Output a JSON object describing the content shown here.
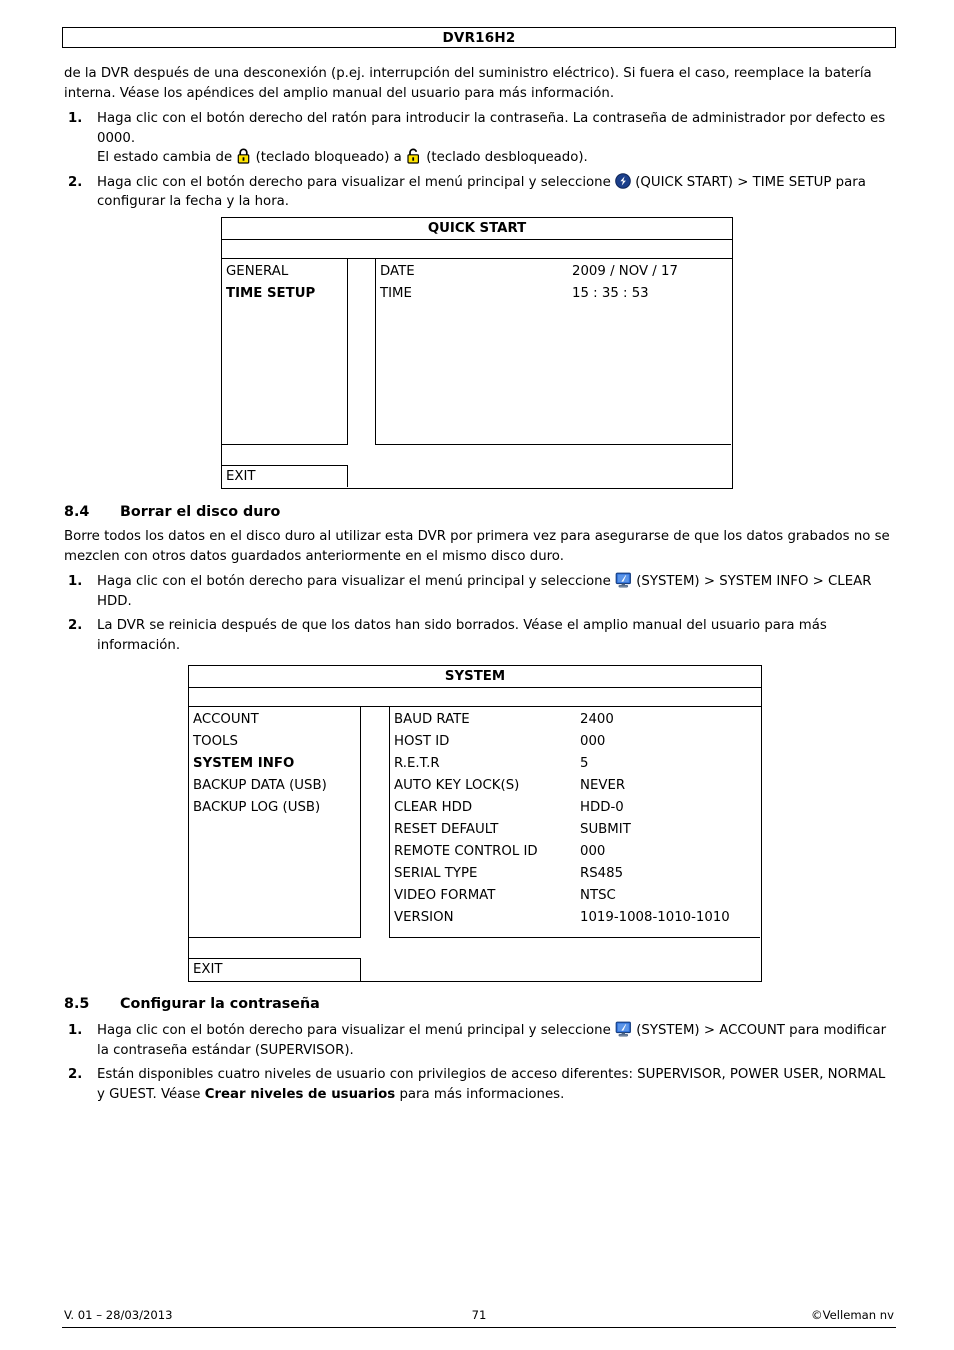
{
  "header": {
    "title": "DVR16H2"
  },
  "intro": {
    "paragraph": "de la DVR después de una desconexión (p.ej. interrupción del suministro eléctrico). Si fuera el caso, reemplace la batería interna. Véase los apéndices del amplio manual del usuario para más información."
  },
  "list_intro": {
    "item1_line1": "Haga clic con el botón derecho del ratón para introducir la contraseña. La contraseña de administrador por defecto es 0000.",
    "item1_line2_a": "El estado cambia de",
    "item1_line2_b": "(teclado bloqueado) a",
    "item1_line2_c": "(teclado desbloqueado).",
    "item1_num": "1.",
    "item2_num": "2.",
    "item2_a": "Haga clic con el botón derecho para visualizar el menú principal y seleccione",
    "item2_b": "(QUICK START) > TIME SETUP para configurar la fecha y la hora."
  },
  "quick_start_menu": {
    "title": "QUICK START",
    "left_items": [
      {
        "label": "GENERAL",
        "active": false
      },
      {
        "label": "TIME SETUP",
        "active": true
      }
    ],
    "rows": [
      {
        "key": "DATE",
        "value": "2009 / NOV / 17"
      },
      {
        "key": "TIME",
        "value": "15 : 35 : 53"
      }
    ],
    "exit_label": "EXIT"
  },
  "section_84": {
    "number": "8.4",
    "title": "Borrar el disco duro",
    "paragraph": "Borre todos los datos en el disco duro al utilizar esta DVR por primera vez para asegurarse de que los datos grabados no se mezclen con otros datos guardados anteriormente en el mismo disco duro.",
    "item1_num": "1.",
    "item1_a": "Haga clic con el botón derecho para visualizar el menú principal y seleccione",
    "item1_b": "(SYSTEM) > SYSTEM INFO > CLEAR HDD.",
    "item2_num": "2.",
    "item2": "La DVR se reinicia después de que los datos han sido borrados. Véase el amplio manual del usuario para más información."
  },
  "system_menu": {
    "title": "SYSTEM",
    "left_items": [
      {
        "label": "ACCOUNT",
        "active": false
      },
      {
        "label": "TOOLS",
        "active": false
      },
      {
        "label": "SYSTEM INFO",
        "active": true
      },
      {
        "label": "BACKUP DATA (USB)",
        "active": false
      },
      {
        "label": "BACKUP LOG (USB)",
        "active": false
      }
    ],
    "rows": [
      {
        "key": "BAUD RATE",
        "value": "2400"
      },
      {
        "key": "HOST ID",
        "value": "000"
      },
      {
        "key": "R.E.T.R",
        "value": "5"
      },
      {
        "key": "AUTO KEY LOCK(S)",
        "value": "NEVER"
      },
      {
        "key": "CLEAR HDD",
        "value": "HDD-0"
      },
      {
        "key": "RESET DEFAULT",
        "value": "SUBMIT"
      },
      {
        "key": "REMOTE CONTROL ID",
        "value": "000"
      },
      {
        "key": "SERIAL TYPE",
        "value": "RS485"
      },
      {
        "key": "VIDEO FORMAT",
        "value": "NTSC"
      },
      {
        "key": "VERSION",
        "value": "1019-1008-1010-1010"
      }
    ],
    "exit_label": "EXIT"
  },
  "section_85": {
    "number": "8.5",
    "title": "Configurar la contraseña",
    "item1_num": "1.",
    "item1_a": "Haga clic con el botón derecho para visualizar el menú principal y seleccione",
    "item1_b": "(SYSTEM) > ACCOUNT para modificar la contraseña estándar (SUPERVISOR).",
    "item2_num": "2.",
    "item2_a": "Están disponibles cuatro niveles de usuario con privilegios de acceso diferentes: SUPERVISOR, POWER USER, NORMAL y GUEST. Véase",
    "item2_bold": "Crear niveles de usuarios",
    "item2_c": "para más informaciones."
  },
  "footer": {
    "left": "V. 01 – 28/03/2013",
    "center": "71",
    "right": "©Velleman nv"
  },
  "icons": {
    "lock_closed": "lock-closed-icon",
    "lock_open": "lock-open-icon",
    "quick_start": "quick-start-icon",
    "system": "system-monitor-icon"
  },
  "colors": {
    "lock_yellow": "#FFE500",
    "lock_outline": "#000000",
    "quick_start_blue": "#1B3F8B",
    "system_blue": "#2E6FD9",
    "text": "#000000",
    "background": "#FFFFFF"
  }
}
